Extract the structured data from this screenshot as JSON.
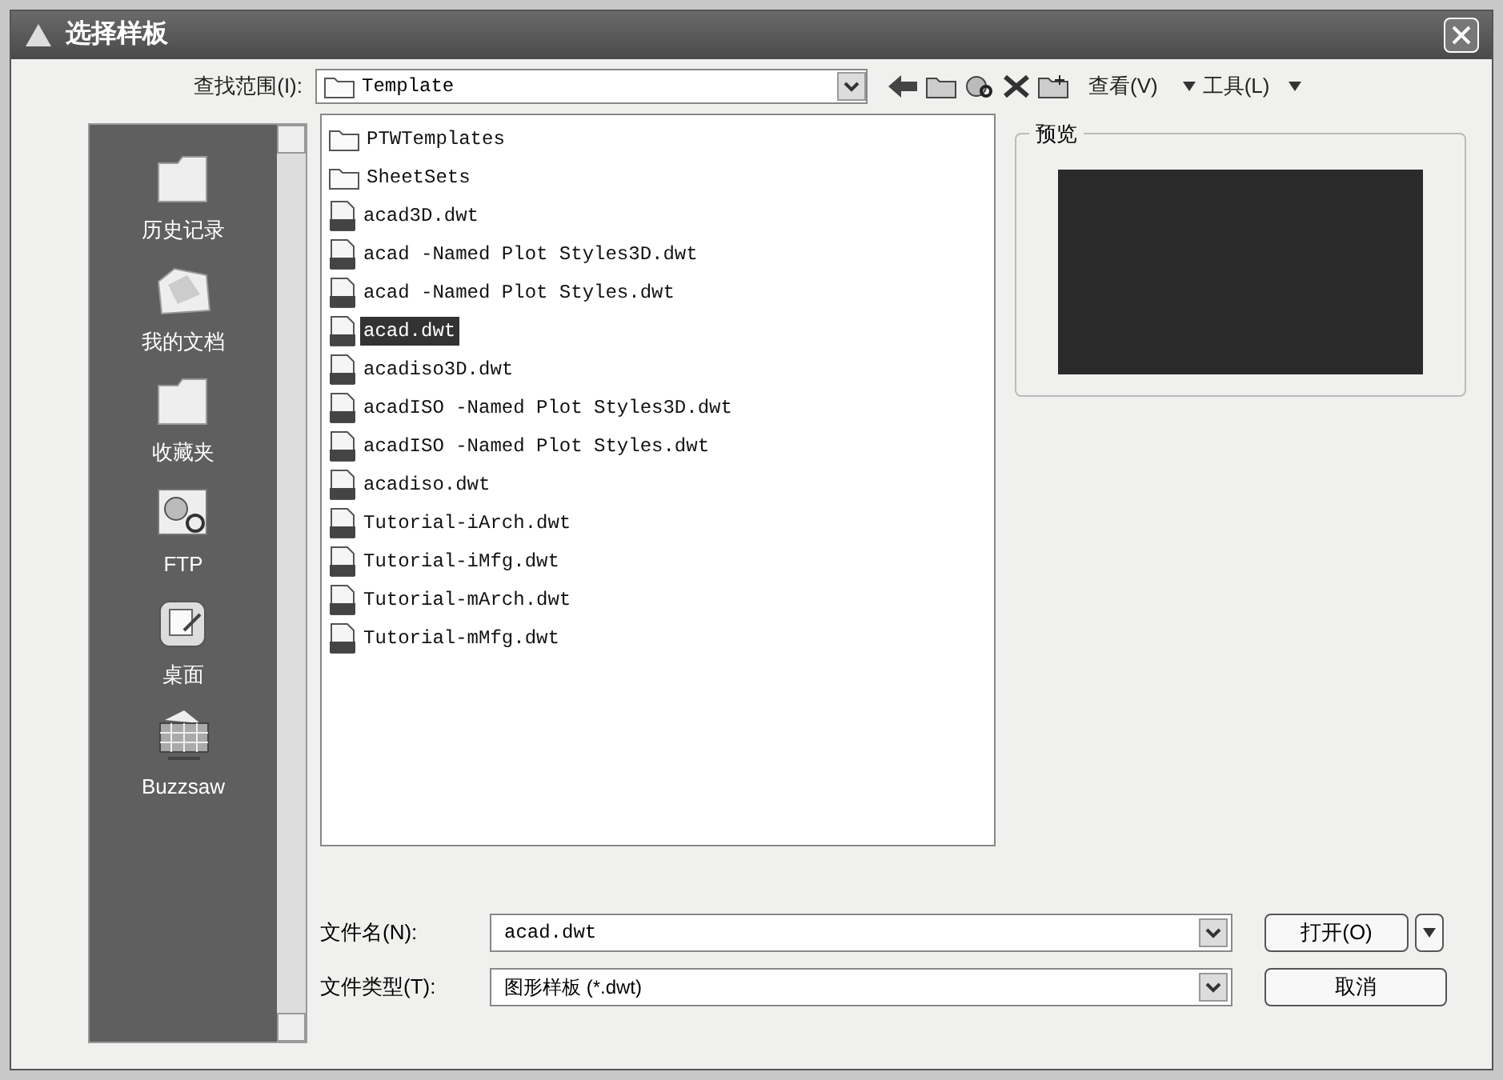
{
  "window": {
    "title": "选择样板"
  },
  "look_in": {
    "label": "查找范围(I):",
    "value": "Template"
  },
  "menus": [
    {
      "label": "查看(V)"
    },
    {
      "label": "工具(L)"
    }
  ],
  "places": [
    {
      "label": "历史记录"
    },
    {
      "label": "我的文档"
    },
    {
      "label": "收藏夹"
    },
    {
      "label": "FTP"
    },
    {
      "label": "桌面"
    },
    {
      "label": "Buzzsaw"
    }
  ],
  "files": [
    {
      "name": "PTWTemplates",
      "kind": "folder",
      "selected": false
    },
    {
      "name": "SheetSets",
      "kind": "folder",
      "selected": false
    },
    {
      "name": "acad3D.dwt",
      "kind": "template",
      "selected": false
    },
    {
      "name": "acad -Named Plot Styles3D.dwt",
      "kind": "template",
      "selected": false
    },
    {
      "name": "acad -Named Plot Styles.dwt",
      "kind": "template",
      "selected": false
    },
    {
      "name": "acad.dwt",
      "kind": "template",
      "selected": true
    },
    {
      "name": "acadiso3D.dwt",
      "kind": "template",
      "selected": false
    },
    {
      "name": "acadISO -Named Plot Styles3D.dwt",
      "kind": "template",
      "selected": false
    },
    {
      "name": "acadISO -Named Plot Styles.dwt",
      "kind": "template",
      "selected": false
    },
    {
      "name": "acadiso.dwt",
      "kind": "template",
      "selected": false
    },
    {
      "name": "Tutorial-iArch.dwt",
      "kind": "template",
      "selected": false
    },
    {
      "name": "Tutorial-iMfg.dwt",
      "kind": "template",
      "selected": false
    },
    {
      "name": "Tutorial-mArch.dwt",
      "kind": "template",
      "selected": false
    },
    {
      "name": "Tutorial-mMfg.dwt",
      "kind": "template",
      "selected": false
    }
  ],
  "preview": {
    "label": "预览"
  },
  "file_name": {
    "label": "文件名(N):",
    "value": "acad.dwt"
  },
  "file_type": {
    "label": "文件类型(T):",
    "value": "图形样板 (*.dwt)"
  },
  "buttons": {
    "open": "打开(O)",
    "cancel": "取消"
  }
}
